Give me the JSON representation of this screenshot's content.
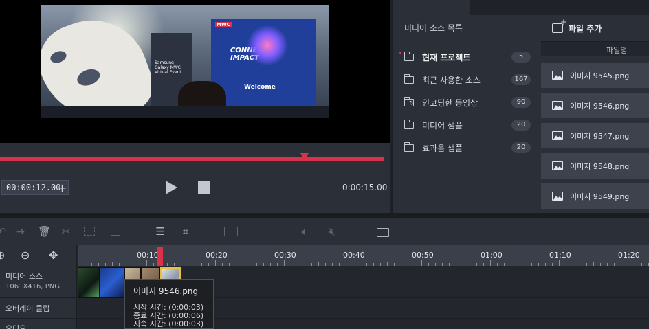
{
  "preview": {
    "video_text": {
      "samsung": "Samsung Galaxy MWC Virtual Event",
      "mwc": "MWC",
      "headline": "CONNECTED IMPACT",
      "welcome": "Welcome"
    },
    "current_time": "00:00:12.00",
    "plus_label": "+",
    "total_time": "0:00:15.00",
    "progress_fraction": 0.8
  },
  "media_panel": {
    "title": "미디어 소스 목록",
    "add_file_label": "파일 추가",
    "filename_header": "파일명",
    "sources": [
      {
        "label": "현재 프로젝트",
        "count": "5",
        "icon": "folder-open-icon",
        "bold": true
      },
      {
        "label": "최근 사용한 소스",
        "count": "167",
        "icon": "folder-icon"
      },
      {
        "label": "인코딩한 동영상",
        "count": "90",
        "icon": "folder-encoded-icon"
      },
      {
        "label": "미디어 샘플",
        "count": "20",
        "icon": "folder-icon"
      },
      {
        "label": "효과음 샘플",
        "count": "20",
        "icon": "folder-icon"
      }
    ],
    "files": [
      {
        "label": "이미지 9545.png",
        "icon": "image-icon"
      },
      {
        "label": "이미지 9546.png",
        "icon": "image-icon"
      },
      {
        "label": "이미지 9547.png",
        "icon": "image-icon"
      },
      {
        "label": "이미지 9548.png",
        "icon": "image-icon"
      },
      {
        "label": "이미지 9549.png",
        "icon": "image-icon"
      }
    ]
  },
  "timeline": {
    "ticks": [
      "00:10",
      "00:20",
      "00:30",
      "00:40",
      "00:50",
      "01:00",
      "01:10",
      "01:20"
    ],
    "tracks": [
      {
        "name": "미디어 소스",
        "sub": "1061X416, PNG"
      },
      {
        "name": "오버레이 클립",
        "sub": ""
      },
      {
        "name": "오디오",
        "sub": ""
      }
    ],
    "tooltip": {
      "title": "이미지 9546.png",
      "start": "시작 시간: (0:00:03)",
      "end": "종료 시간: (0:00:06)",
      "duration": "지속 시간: (0:00:03)"
    }
  },
  "colors": {
    "accent": "#d8334a",
    "selection": "#e6c33a",
    "panel": "#2b2f37"
  }
}
